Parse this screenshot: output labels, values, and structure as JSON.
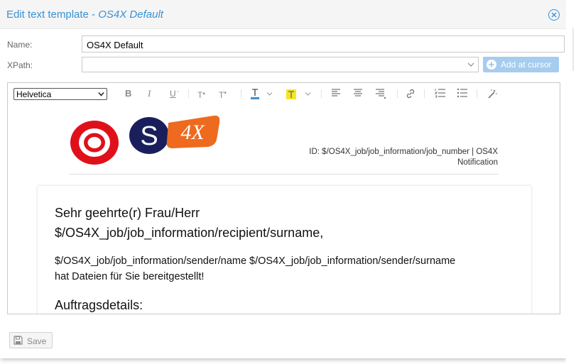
{
  "dialog": {
    "title_prefix": "Edit text template - ",
    "title_name": "OS4X Default"
  },
  "form": {
    "name_label": "Name:",
    "name_value": "OS4X Default",
    "xpath_label": "XPath:",
    "xpath_value": "",
    "add_button_label": "Add at cursor"
  },
  "toolbar": {
    "font_value": "Helvetica",
    "buttons": [
      "bold",
      "italic",
      "underline",
      "superscript",
      "subscript",
      "text-color",
      "highlight-color",
      "align-left",
      "align-center",
      "align-right",
      "link",
      "ordered-list",
      "unordered-list",
      "clear-format"
    ]
  },
  "template": {
    "logo_letters": [
      "O",
      "S",
      "4X"
    ],
    "id_line1": "ID: $/OS4X_job/job_information/job_number | OS4X",
    "id_line2": "Notification",
    "greeting_line1": "Sehr geehrte(r) Frau/Herr",
    "greeting_line2": "$/OS4X_job/job_information/recipient/surname,",
    "body_line1": "$/OS4X_job/job_information/sender/name $/OS4X_job/job_information/sender/surname",
    "body_line2": "hat Dateien für Sie bereitgestellt!",
    "section_heading": "Auftragsdetails:"
  },
  "footer": {
    "save_label": "Save"
  },
  "colors": {
    "accent": "#3892d4",
    "logo_red": "#e0101b",
    "logo_navy": "#1a1f5c",
    "logo_orange": "#ee6a1e"
  }
}
